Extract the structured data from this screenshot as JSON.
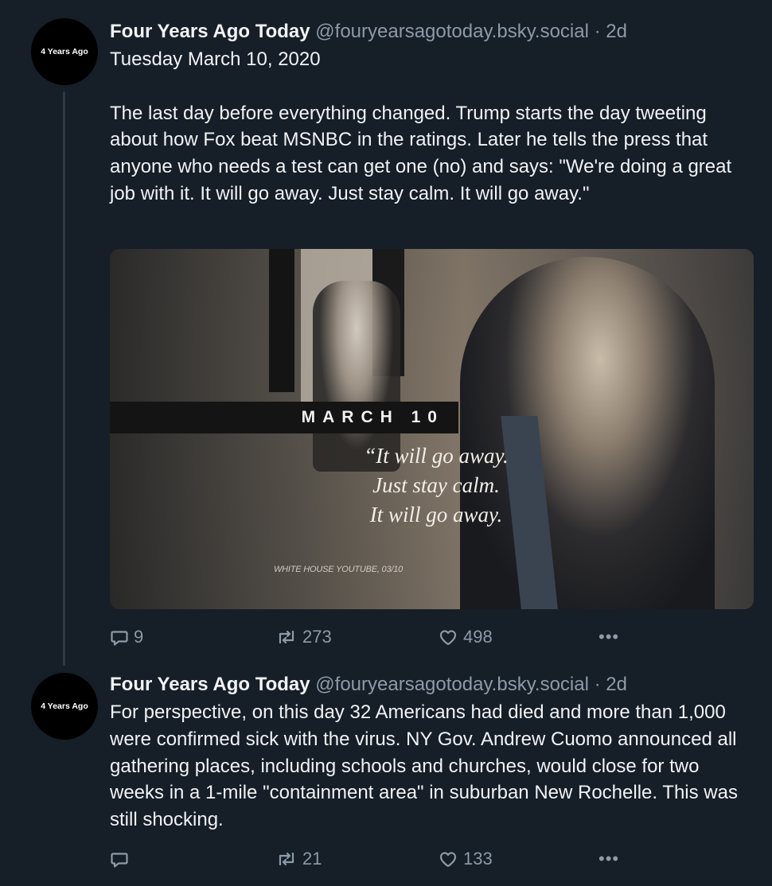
{
  "posts": [
    {
      "avatar_text": "4 Years Ago",
      "author_name": "Four Years Ago Today",
      "handle": "@fouryearsagotoday.bsky.social",
      "separator": "·",
      "time": "2d",
      "text": "Tuesday March 10, 2020\n\nThe last day before everything changed. Trump starts the day tweeting about how Fox beat MSNBC in the ratings. Later he tells the press that anyone who needs a test can get one (no) and says: \"We're doing a great job with it. It will go away. Just stay calm. It will go away.\"",
      "image": {
        "banner_text": "MARCH 10",
        "quote_text": "“It will go away.\nJust stay calm.\nIt will go away.",
        "credit_text": "WHITE HOUSE YOUTUBE, 03/10"
      },
      "reply_count": "9",
      "repost_count": "273",
      "like_count": "498",
      "more_label": "•••"
    },
    {
      "avatar_text": "4 Years Ago",
      "author_name": "Four Years Ago Today",
      "handle": "@fouryearsagotoday.bsky.social",
      "separator": "·",
      "time": "2d",
      "text": "For perspective, on this day 32 Americans had died and more than 1,000 were confirmed sick with the virus. NY Gov. Andrew Cuomo announced all gathering places, including schools and churches, would close for two weeks in a 1-mile \"containment area\" in suburban New Rochelle. This was still shocking.",
      "reply_count": "",
      "repost_count": "21",
      "like_count": "133",
      "more_label": "•••"
    }
  ],
  "icons": [
    "reply-icon",
    "repost-icon",
    "like-icon",
    "more-icon"
  ],
  "colors": {
    "background": "#161e27",
    "muted": "#8d9aa8",
    "text": "#f1f3f5",
    "thread_line": "#2e3a47"
  }
}
